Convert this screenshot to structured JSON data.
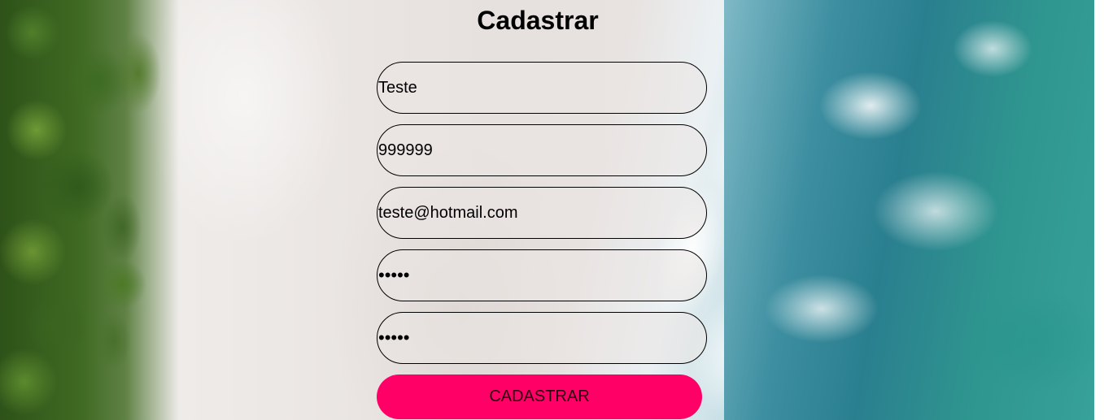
{
  "form": {
    "title": "Cadastrar",
    "fields": [
      {
        "name": "name",
        "type": "text",
        "value": "Teste"
      },
      {
        "name": "phone",
        "type": "text",
        "value": "999999"
      },
      {
        "name": "email",
        "type": "text",
        "value": "teste@hotmail.com"
      },
      {
        "name": "password",
        "type": "password",
        "value": "•••••"
      },
      {
        "name": "confirm_password",
        "type": "password",
        "value": "•••••"
      }
    ],
    "submit_label": "CADASTRAR"
  },
  "colors": {
    "submit_button": "#ff0066",
    "field_border": "#000000",
    "title_text": "#000000"
  },
  "background": {
    "scene": "aerial-beach-photo"
  }
}
